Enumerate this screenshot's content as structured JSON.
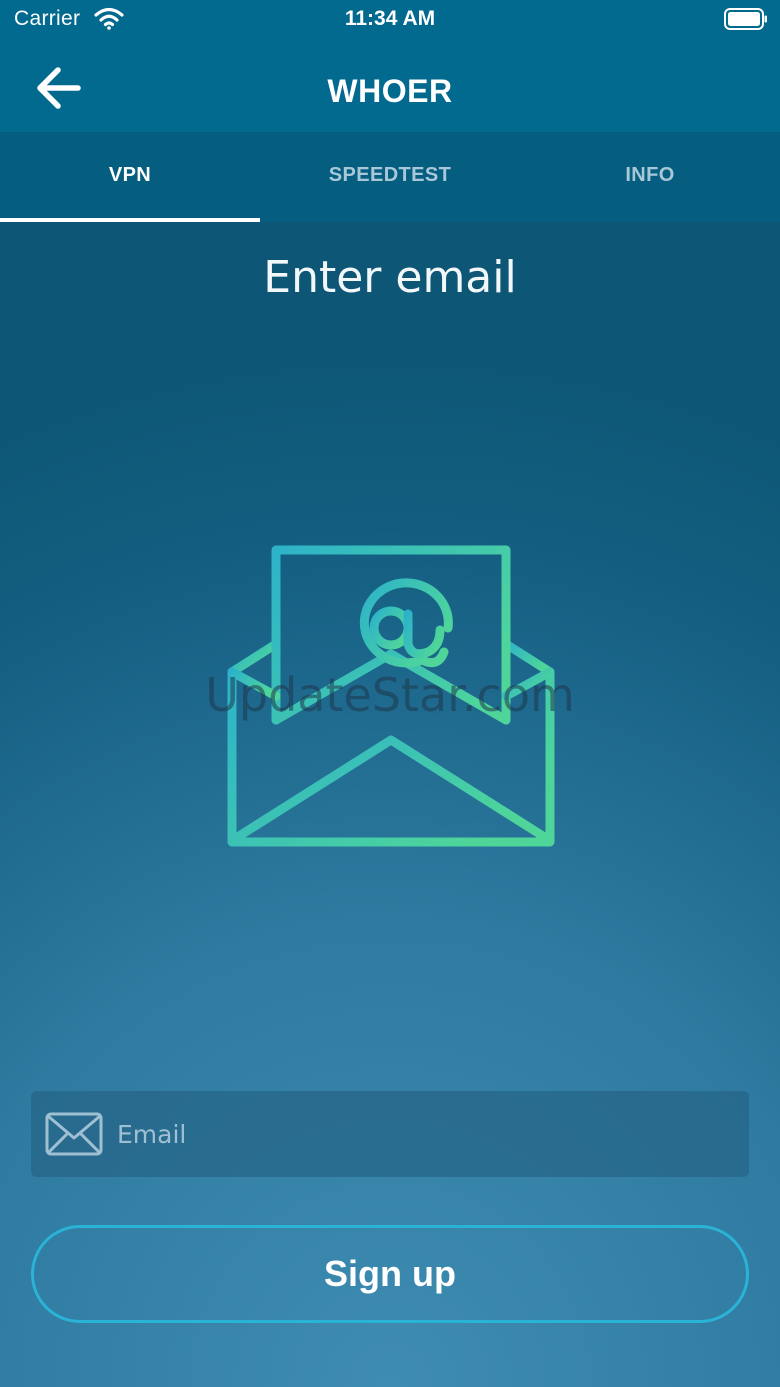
{
  "status_bar": {
    "carrier": "Carrier",
    "time": "11:34 AM",
    "icons": [
      "wifi-icon",
      "battery-icon"
    ]
  },
  "nav": {
    "title": "WHOER",
    "back_icon": "arrow-left-icon"
  },
  "tabs": [
    {
      "label": "VPN",
      "active": true
    },
    {
      "label": "SPEEDTEST",
      "active": false
    },
    {
      "label": "INFO",
      "active": false
    }
  ],
  "main": {
    "heading": "Enter email",
    "illustration_icon": "open-envelope-at-icon",
    "watermark": "UpdateStar.com"
  },
  "form": {
    "email": {
      "placeholder": "Email",
      "value": "",
      "icon": "mail-icon"
    },
    "signup_label": "Sign up"
  },
  "colors": {
    "header": "#02698f",
    "tab_bar": "#055d80",
    "button_border": "#2ab3d6",
    "illustration_start": "#2db3c9",
    "illustration_end": "#4fd59a"
  }
}
